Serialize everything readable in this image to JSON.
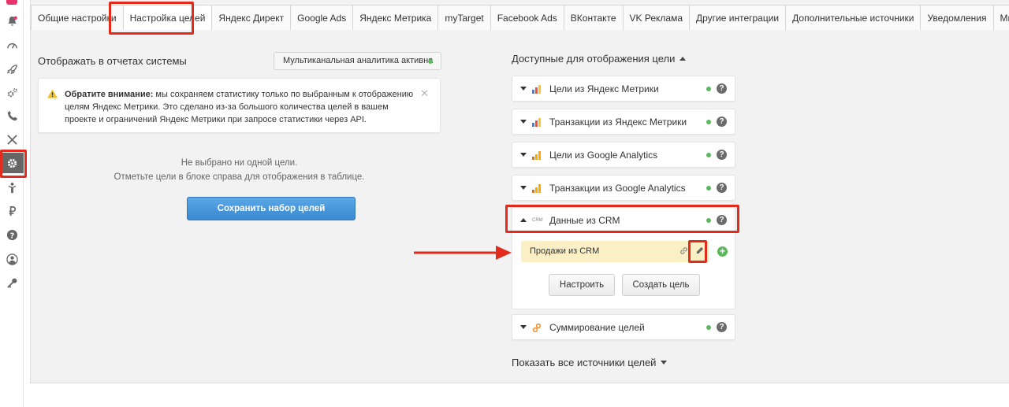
{
  "tabs": [
    {
      "label": "Общие настройки"
    },
    {
      "label": "Настройка целей"
    },
    {
      "label": "Яндекс Директ"
    },
    {
      "label": "Google Ads"
    },
    {
      "label": "Яндекс Метрика"
    },
    {
      "label": "myTarget"
    },
    {
      "label": "Facebook Ads"
    },
    {
      "label": "ВКонтакте"
    },
    {
      "label": "VK Реклама"
    },
    {
      "label": "Другие интеграции"
    },
    {
      "label": "Дополнительные источники"
    },
    {
      "label": "Уведомления"
    },
    {
      "label": "Множители"
    }
  ],
  "left": {
    "title": "Отображать в отчетах системы",
    "multichannel_label": "Мультиканальная аналитика активна",
    "notice_bold": "Обратите внимание:",
    "notice_text": " мы сохраняем статистику только по выбранным к отображению целям Яндекс Метрики. Это сделано из-за большого количества целей в вашем проекте и ограничений Яндекс Метрики при запросе статистики через API.",
    "empty_line1": "Не выбрано ни одной цели.",
    "empty_line2": "Отметьте цели в блоке справа для отображения в таблице.",
    "save_label": "Сохранить набор целей"
  },
  "right": {
    "title": "Доступные для отображения цели",
    "sources": [
      {
        "label": "Цели из Яндекс Метрики"
      },
      {
        "label": "Транзакции из Яндекс Метрики"
      },
      {
        "label": "Цели из Google Analytics"
      },
      {
        "label": "Транзакции из Google Analytics"
      },
      {
        "label": "Данные из CRM",
        "icon_text": "CRM"
      },
      {
        "label": "Суммирование целей"
      }
    ],
    "crm_goal": "Продажи из CRM",
    "configure_label": "Настроить",
    "create_goal_label": "Создать цель",
    "show_all_label": "Показать все источники целей"
  },
  "colors": {
    "accent_red": "#e32b1d",
    "primary_blue": "#3a88cf",
    "status_green": "#5cb85c",
    "highlight_yellow": "#fbefc6"
  }
}
